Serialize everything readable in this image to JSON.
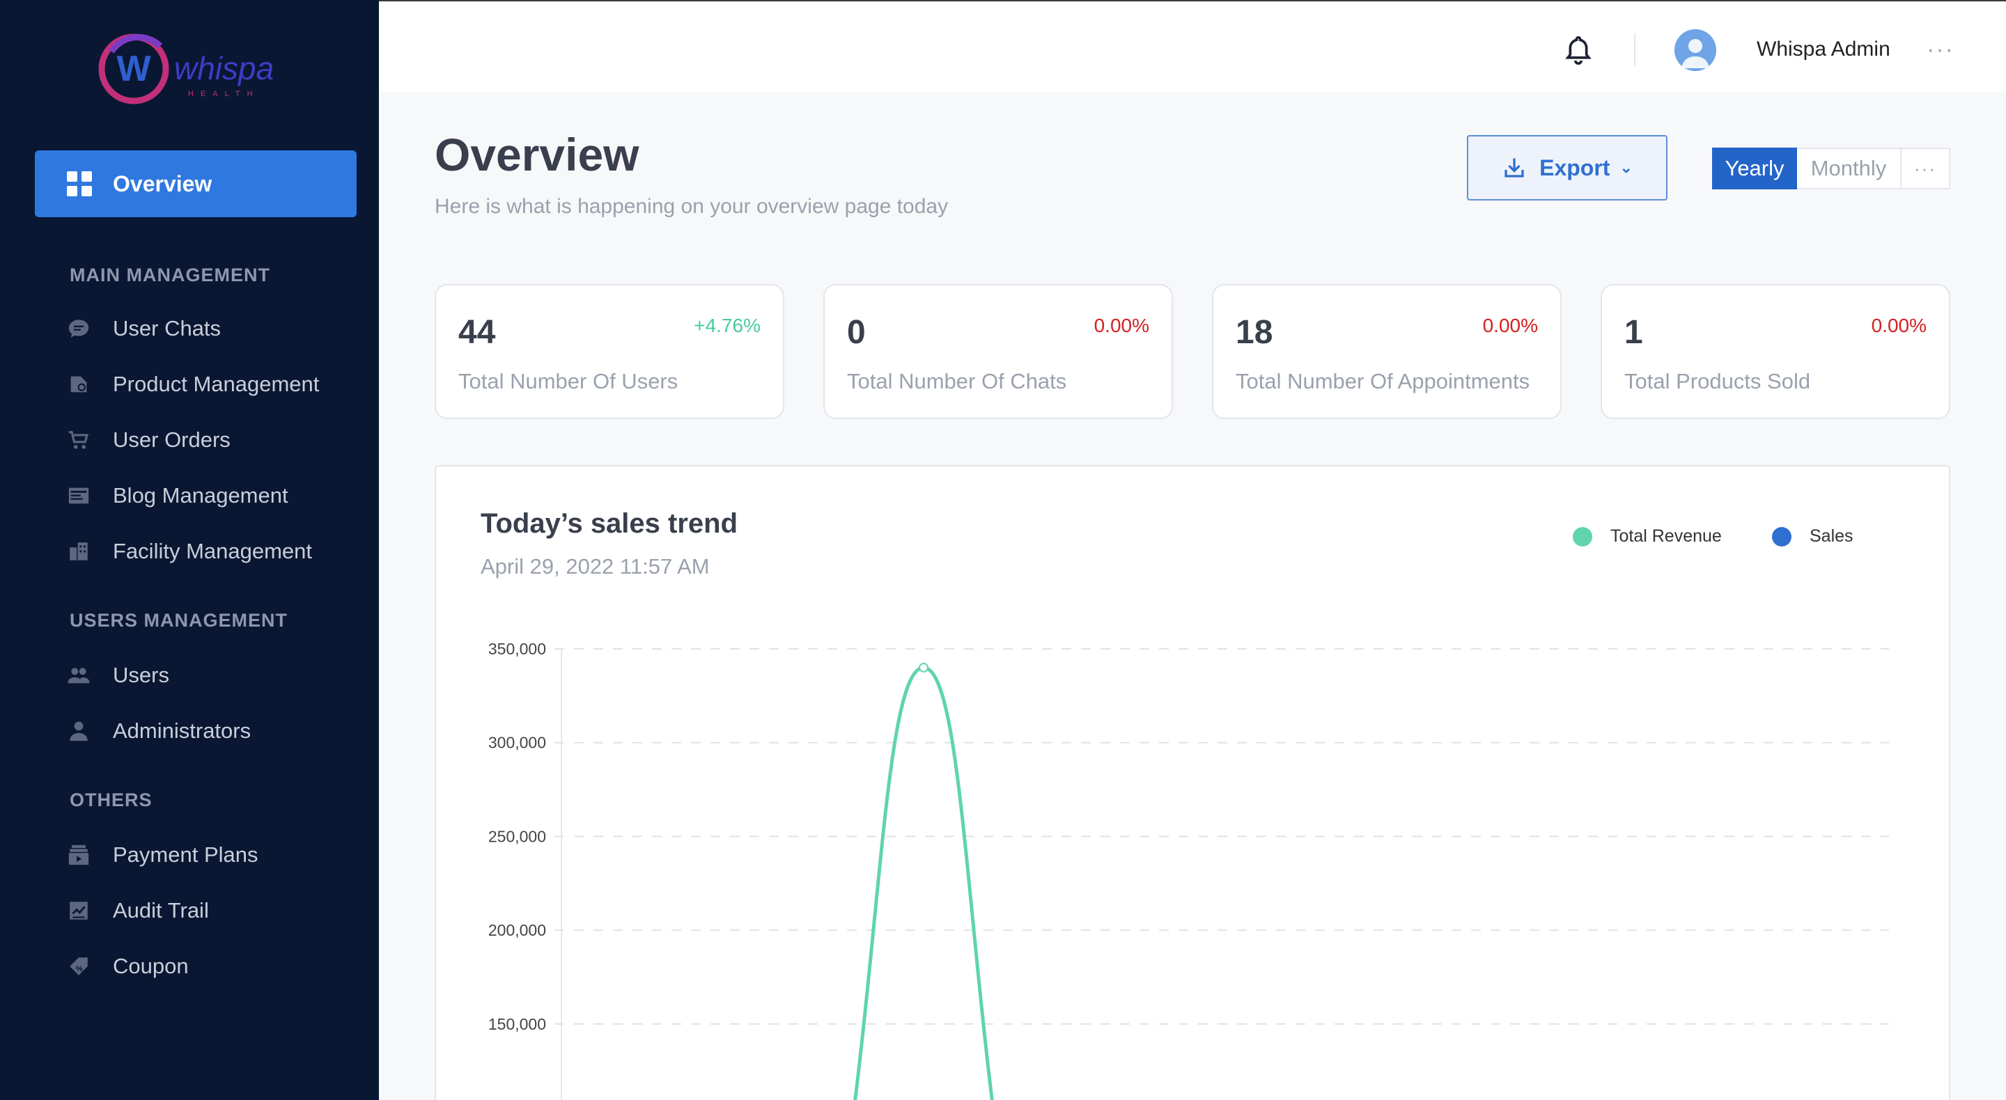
{
  "app": {
    "brand": "whispa",
    "brand_sub": "HEALTH",
    "colors": {
      "sidebar_bg": "#0a1733",
      "accent": "#2f78e0",
      "positive": "#49c9a3",
      "negative": "#d42020"
    }
  },
  "sidebar": {
    "active_item": {
      "label": "Overview",
      "icon": "grid-icon"
    },
    "sections": [
      {
        "title": "MAIN MANAGEMENT",
        "items": [
          {
            "label": "User Chats",
            "icon": "chat-icon"
          },
          {
            "label": "Product Management",
            "icon": "product-icon"
          },
          {
            "label": "User Orders",
            "icon": "cart-icon"
          },
          {
            "label": "Blog Management",
            "icon": "blog-icon"
          },
          {
            "label": "Facility Management",
            "icon": "building-icon"
          }
        ]
      },
      {
        "title": "USERS MANAGEMENT",
        "items": [
          {
            "label": "Users",
            "icon": "users-icon"
          },
          {
            "label": "Administrators",
            "icon": "admin-icon"
          }
        ]
      },
      {
        "title": "OTHERS",
        "items": [
          {
            "label": "Payment Plans",
            "icon": "payment-icon"
          },
          {
            "label": "Audit Trail",
            "icon": "audit-icon"
          },
          {
            "label": "Coupon",
            "icon": "coupon-icon"
          }
        ]
      }
    ]
  },
  "topbar": {
    "user_name": "Whispa Admin",
    "more": "···"
  },
  "header": {
    "title": "Overview",
    "subtitle": "Here is what is happening on your overview page today",
    "export_label": "Export",
    "periods": [
      "Yearly",
      "Monthly"
    ],
    "active_period": "Yearly",
    "more": "···"
  },
  "stats": [
    {
      "value": "44",
      "change": "+4.76%",
      "label": "Total Number Of Users",
      "trend": "positive"
    },
    {
      "value": "0",
      "change": "0.00%",
      "label": "Total Number Of Chats",
      "trend": "negative"
    },
    {
      "value": "18",
      "change": "0.00%",
      "label": "Total Number Of Appointments",
      "trend": "negative"
    },
    {
      "value": "1",
      "change": "0.00%",
      "label": "Total Products Sold",
      "trend": "negative"
    }
  ],
  "chart": {
    "title": "Today’s sales trend",
    "date": "April 29, 2022 11:57 AM",
    "legend": [
      {
        "name": "Total Revenue",
        "color": "#5fd4ad"
      },
      {
        "name": "Sales",
        "color": "#2f6fd0"
      }
    ]
  },
  "chart_data": {
    "type": "line",
    "title": "Today’s sales trend",
    "yticks": [
      "350,000",
      "300,000",
      "250,000",
      "200,000",
      "150,000"
    ],
    "ylim": [
      150000,
      350000
    ],
    "grid": true,
    "legend_position": "top-right",
    "series": [
      {
        "name": "Total Revenue",
        "color": "#5fd4ad",
        "peak_value": 340000
      },
      {
        "name": "Sales",
        "color": "#2f6fd0"
      }
    ]
  }
}
